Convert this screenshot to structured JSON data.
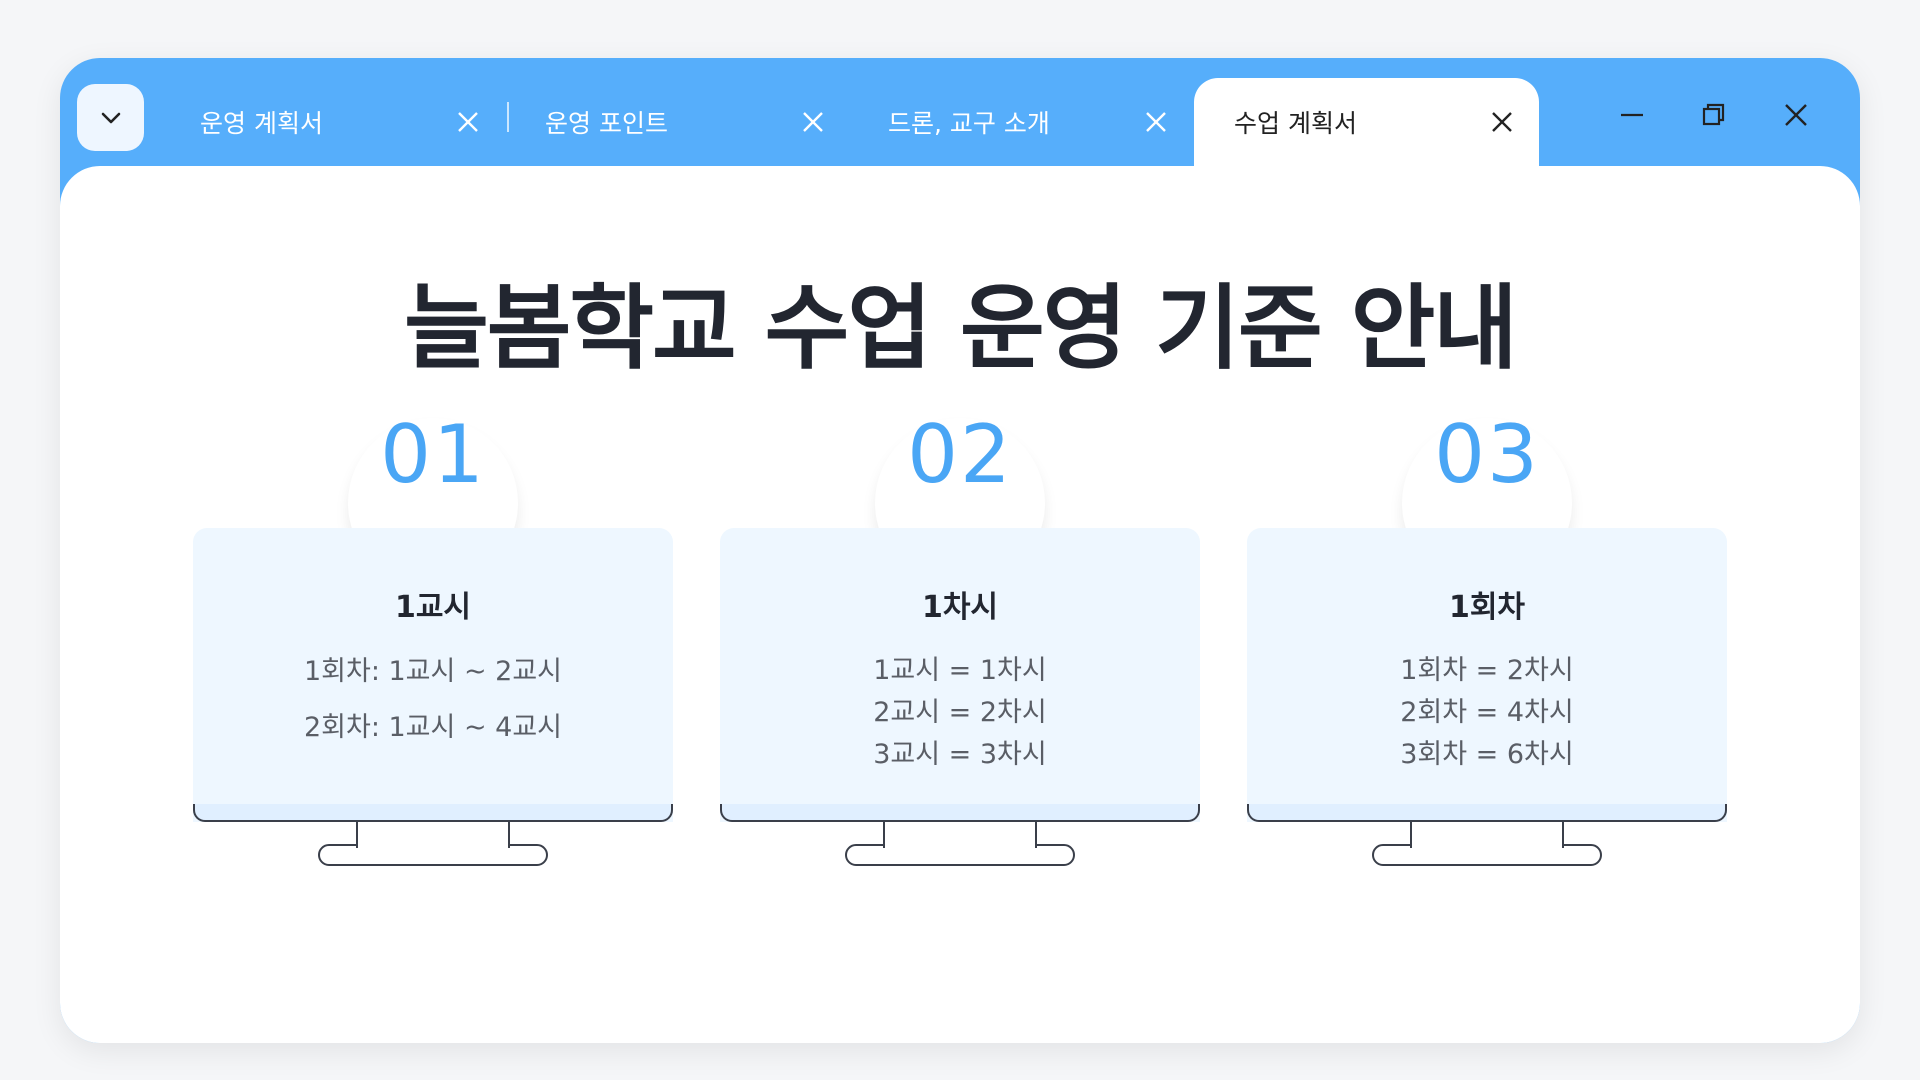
{
  "tabs": [
    {
      "label": "운영 계획서",
      "active": false
    },
    {
      "label": "운영 포인트",
      "active": false
    },
    {
      "label": "드론, 교구 소개",
      "active": false
    },
    {
      "label": "수업 계획서",
      "active": true
    }
  ],
  "icons": {
    "menu": "chevron-down-icon",
    "close": "close-icon",
    "minimize": "minimize-icon",
    "restore": "restore-icon"
  },
  "colors": {
    "accent": "#56aefb",
    "number": "#4aa6f5",
    "card_bg": "#eef7ff",
    "title": "#222630"
  },
  "page": {
    "title": "늘봄학교 수업 운영 기준 안내"
  },
  "cards": [
    {
      "number": "01",
      "heading": "1교시",
      "lines": [
        "1회차: 1교시 ~ 2교시",
        "2회차: 1교시 ~ 4교시"
      ]
    },
    {
      "number": "02",
      "heading": "1차시",
      "lines": [
        "1교시 = 1차시",
        "2교시 = 2차시",
        "3교시 = 3차시"
      ]
    },
    {
      "number": "03",
      "heading": "1회차",
      "lines": [
        "1회차 = 2차시",
        "2회차 = 4차시",
        "3회차 = 6차시"
      ]
    }
  ]
}
